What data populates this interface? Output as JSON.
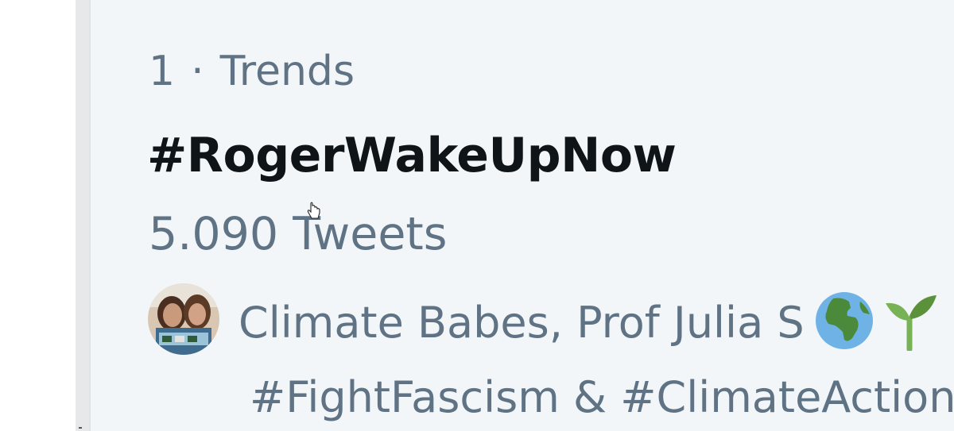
{
  "trend": {
    "rank": "1",
    "separator": "·",
    "category": "Trends",
    "hashtag": "#RogerWakeUpNow",
    "tweet_count": "5.090 Tweets",
    "context_names": "Climate Babes, Prof Julia S",
    "context_hashtags": "#FightFascism & #ClimateAction",
    "emojis": [
      "globe-africa",
      "seedling"
    ]
  },
  "colors": {
    "panel_bg": "#f3f6f9",
    "secondary_text": "#5f7385",
    "primary_text": "#0f1419"
  }
}
